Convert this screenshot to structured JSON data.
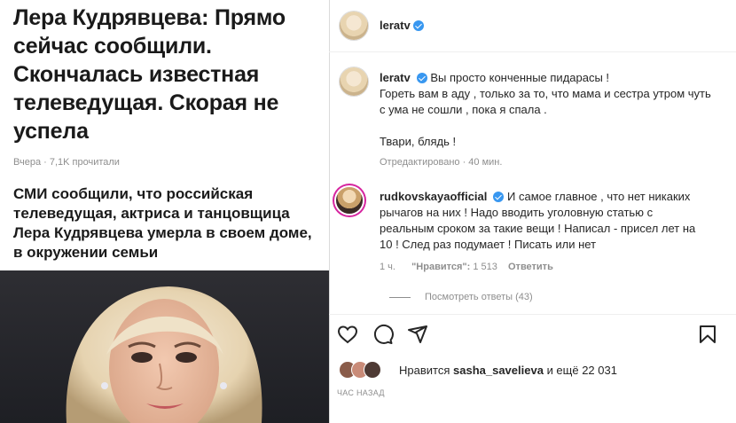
{
  "article": {
    "headline": "Лера Кудрявцева: Прямо сейчас сообщили. Скончалась известная телеведущая. Скорая не успела",
    "meta": "Вчера · 7,1K прочитали",
    "lead": "СМИ сообщили, что российская телеведущая, актриса и танцовщица Лера Кудрявцева умерла в своем доме, в окружении семьи"
  },
  "post": {
    "author": "leratv",
    "caption": {
      "user": "leratv",
      "line1": "Вы просто конченные пидарасы !",
      "line2": "Гореть вам в аду , только за то, что мама и сестра утром чуть",
      "line3": "с ума не сошли , пока я спала .",
      "line4": "Твари, блядь !",
      "edited": "Отредактировано · 40 мин."
    },
    "comment": {
      "user": "rudkovskayaofficial",
      "line1": "И самое главное , что нет никаких",
      "line2": "рычагов на них ! Надо вводить уголовную статью с",
      "line3": "реальным сроком за такие вещи ! Написал - присел лет на",
      "line4": "10 ! След раз подумает ! Писать или нет",
      "age": "1 ч.",
      "likes_label": "\"Нравится\":",
      "likes_count": "1 513",
      "reply": "Ответить",
      "view_replies": "Посмотреть ответы (43)"
    },
    "likes": {
      "prefix": "Нравится",
      "user": "sasha_savelieva",
      "suffix": "и ещё 22 031"
    },
    "time": "ЧАС НАЗАД"
  },
  "colors": {
    "accent": "#3897f0",
    "muted": "#8e8e8e",
    "text": "#262626"
  },
  "icons": [
    "heart-icon",
    "comment-icon",
    "share-icon",
    "bookmark-icon",
    "verified-icon"
  ]
}
